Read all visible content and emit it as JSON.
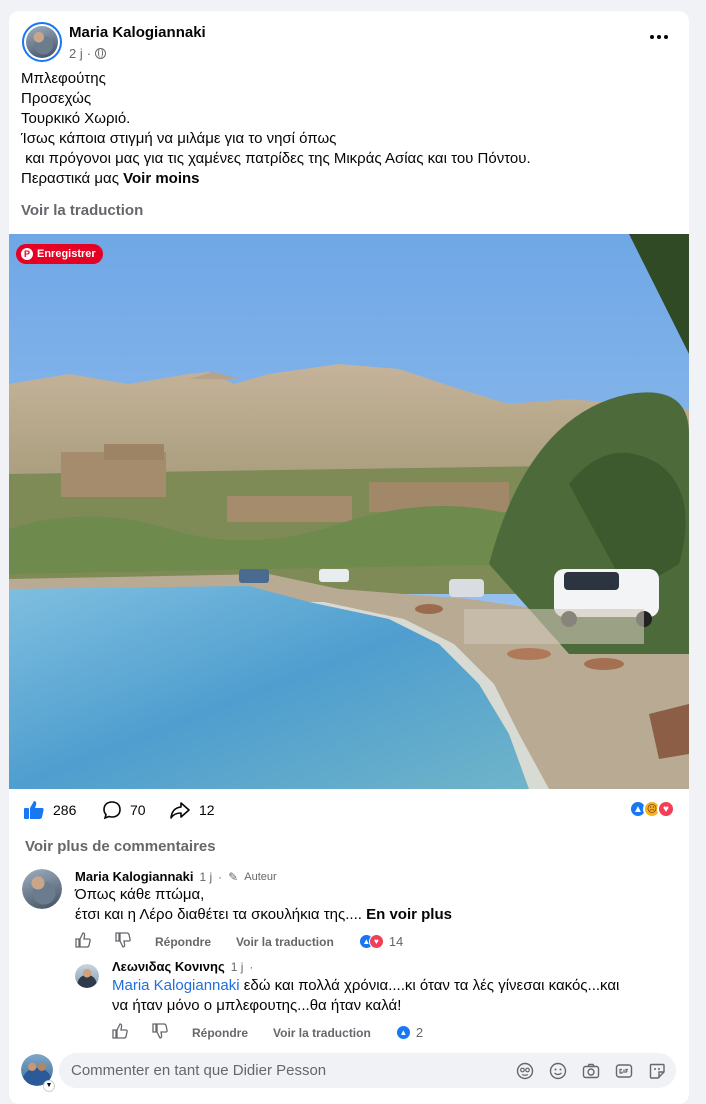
{
  "post": {
    "author": "Maria Kalogiannaki",
    "time": "2 j",
    "dot": "·",
    "lines": [
      "Μπλεφούτης",
      "Προσεχώς",
      "Τουρκικό Χωριό.",
      "Ίσως κάποια στιγμή να μιλάμε για το νησί όπως",
      " και πρόγονοι μας για τις χαμένες πατρίδες της Μικράς Ασίας και του Πόντου."
    ],
    "last_line": "Περαστικά μας ",
    "see_less": "Voir moins",
    "translate": "Voir la traduction",
    "pinterest_label": "Enregistrer",
    "likes": "286",
    "comments": "70",
    "shares": "12"
  },
  "comments_section": {
    "see_more": "Voir plus de commentaires",
    "comment1": {
      "author": "Maria Kalogiannaki",
      "time": "1 j",
      "dot": "·",
      "badge": "Auteur",
      "line1": "Όπως κάθε πτώμα,",
      "line2": "έτσι και η Λέρο διαθέτει τα σκουλήκια της....",
      "see_more": "En voir plus",
      "reply": "Répondre",
      "translate": "Voir la traduction",
      "reactions": "14"
    },
    "comment2": {
      "author": "Λεωνιδας Κονινης",
      "time": "1 j",
      "dot": "·",
      "mention": "Maria Kalogiannaki",
      "line1": " εδώ και πολλά χρόνια....κι όταν τα λές γίνεσαι κακός...και",
      "line2": "να ήταν μόνο ο μπλεφουτης...θα ήταν καλά!",
      "reply": "Répondre",
      "translate": "Voir la traduction",
      "reactions": "2"
    }
  },
  "composer": {
    "placeholder": "Commenter en tant que Didier Pesson"
  },
  "colors": {
    "accent": "#1877f2",
    "pinterest": "#e60023",
    "love": "#f33e58"
  }
}
